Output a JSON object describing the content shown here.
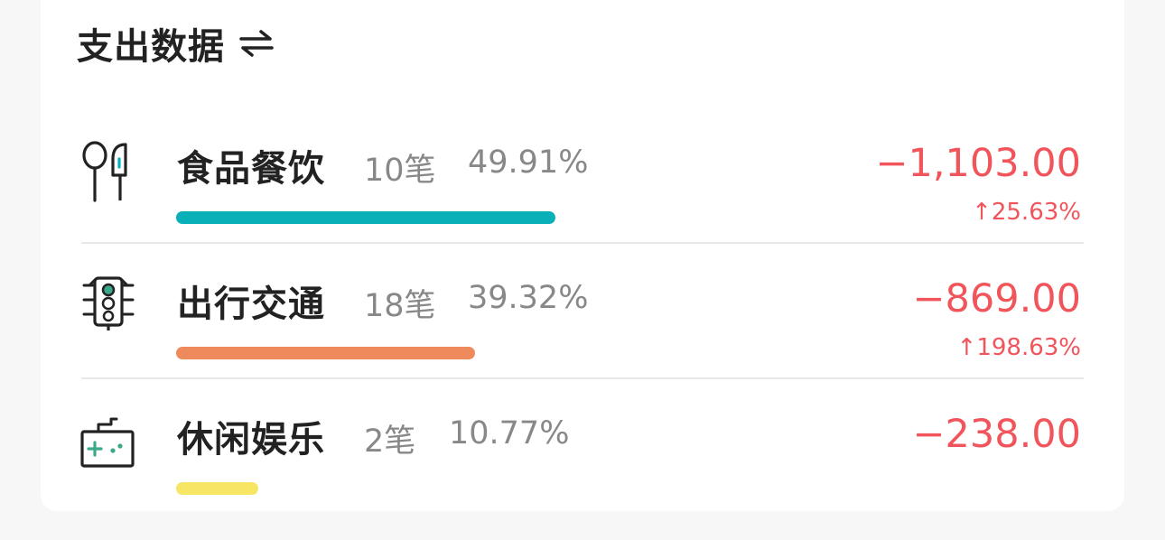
{
  "header": {
    "title": "支出数据",
    "swap_icon": "swap-arrows-icon"
  },
  "colors": {
    "negative": "#f2545b",
    "food": "#0ab0b8",
    "transport": "#ef8a5c",
    "leisure": "#f7e564"
  },
  "categories": [
    {
      "name": "食品餐饮",
      "count": "10笔",
      "percent": "49.91%",
      "amount": "−1,103.00",
      "change": "↑25.63%",
      "icon": "utensils-icon",
      "share": 0.4991
    },
    {
      "name": "出行交通",
      "count": "18笔",
      "percent": "39.32%",
      "amount": "−869.00",
      "change": "↑198.63%",
      "icon": "traffic-light-icon",
      "share": 0.3932
    },
    {
      "name": "休闲娱乐",
      "count": "2笔",
      "percent": "10.77%",
      "amount": "−238.00",
      "change": "",
      "icon": "gamepad-icon",
      "share": 0.1077
    }
  ]
}
